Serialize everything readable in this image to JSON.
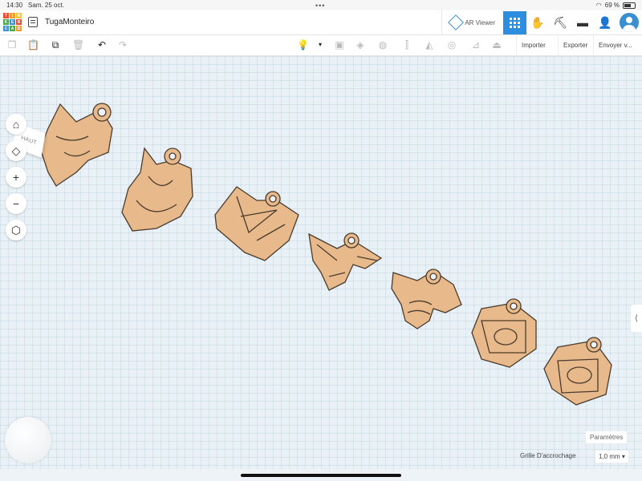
{
  "status_bar": {
    "time": "14:30",
    "date": "Sam. 25 oct.",
    "battery": "69 %"
  },
  "header": {
    "logo_letters": [
      "T",
      "I",
      "N",
      "K",
      "E",
      "R",
      "C",
      "A",
      "D"
    ],
    "logo_colors": [
      "#e94f37",
      "#f39c33",
      "#f3c833",
      "#4aa84a",
      "#3a8fd0",
      "#e94f37",
      "#3a8fd0",
      "#4aa84a",
      "#f39c33"
    ],
    "project_title": "TugaMonteiro",
    "ar_viewer_label": "AR Viewer"
  },
  "toolbar": {
    "import_label": "Importer",
    "export_label": "Exporter",
    "send_label": "Envoyer v..."
  },
  "viewcube_label": "HAUT",
  "bottom": {
    "parameters_label": "Paramètres",
    "snap_grid_label": "Grille D'accrochage",
    "snap_grid_value": "1,0 mm ▾"
  },
  "colors": {
    "accent": "#2d8ee0",
    "shape": "#e8b98a",
    "shape_outline": "#4a3b2f"
  }
}
